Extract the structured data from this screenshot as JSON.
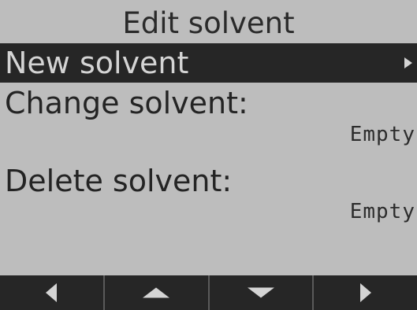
{
  "title": "Edit solvent",
  "menu": {
    "items": [
      {
        "label": "New solvent",
        "selected": true
      },
      {
        "label": "Change solvent:",
        "value": "Empty"
      },
      {
        "label": "Delete solvent:",
        "value": "Empty"
      }
    ]
  },
  "softkeys": [
    {
      "icon": "arrow-left-icon"
    },
    {
      "icon": "arrow-up-icon"
    },
    {
      "icon": "arrow-down-icon"
    },
    {
      "icon": "arrow-right-icon"
    }
  ],
  "colors": {
    "background": "#bdbdbd",
    "highlight": "#262626",
    "highlight_text": "#d4d4d4",
    "text": "#242424"
  }
}
